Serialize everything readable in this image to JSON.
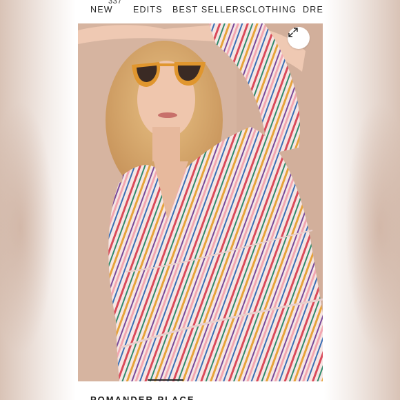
{
  "nav": {
    "items": [
      "NEW",
      "EDITS",
      "BEST SELLERS",
      "CLOTHING",
      "DRES"
    ],
    "badge": "337"
  },
  "product": {
    "brand": "POMANDER PLACE"
  },
  "photo": {
    "description_icon": "expand-icon"
  },
  "colors": {
    "stripe_palette": [
      "#d94a5a",
      "#2f8a6b",
      "#e6a33a",
      "#7a4a9a",
      "#f2a6b0",
      "#3a6fb5"
    ],
    "sunglasses": "#e0962e"
  }
}
